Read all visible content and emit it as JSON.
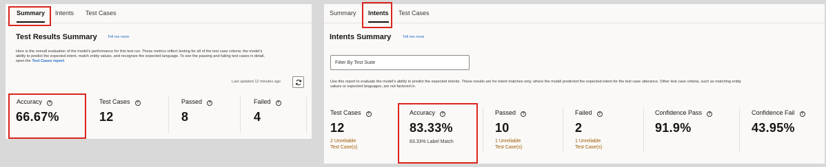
{
  "left": {
    "tabs": [
      "Summary",
      "Intents",
      "Test Cases"
    ],
    "active_tab": "Summary",
    "title": "Test Results Summary",
    "tell_me": "Tell me more",
    "description": "Here is the overall evaluation of the model's performance for this test run. These metrics reflect testing for all of the test case criteria: the model's ability to predict the expected intent, match entity values, and recognize the expected language. To see the passing and failing test cases in detail, open the ",
    "description_link": "Test Cases report",
    "last_updated": "Last updated 12 minutes ago",
    "metrics": [
      {
        "label": "Accuracy",
        "value": "66.67%"
      },
      {
        "label": "Test Cases",
        "value": "12"
      },
      {
        "label": "Passed",
        "value": "8"
      },
      {
        "label": "Failed",
        "value": "4"
      }
    ]
  },
  "right": {
    "tabs": [
      "Summary",
      "Intents",
      "Test Cases"
    ],
    "active_tab": "Intents",
    "title": "Intents Summary",
    "tell_me": "Tell me more",
    "filter_placeholder": "Filter By Test Suite",
    "description": "Use this report to evaluate the model's ability to predict the expected intents. These results are for intent matches only, where the model predicted the expected intent for the test case utterance. Other test case criteria, such as matching entity values or expected languages, are not factored in.",
    "metrics": [
      {
        "label": "Test Cases",
        "value": "12",
        "sub": [
          "2 Unreliable",
          "Test Case(s)"
        ]
      },
      {
        "label": "Accuracy",
        "value": "83.33%",
        "sub": [
          "83.33% Label Match"
        ]
      },
      {
        "label": "Passed",
        "value": "10",
        "sub": [
          "1 Unreliable",
          "Test Case(s)"
        ]
      },
      {
        "label": "Failed",
        "value": "2",
        "sub": [
          "1 Unreliable",
          "Test Case(s)"
        ]
      },
      {
        "label": "Confidence Pass",
        "value": "91.9%"
      },
      {
        "label": "Confidence Fail",
        "value": "43.95%"
      }
    ]
  },
  "help_glyph": "?",
  "colors": {
    "highlight": "#d9241c",
    "link": "#1f6ec4",
    "warning_text": "#9a5b00"
  }
}
